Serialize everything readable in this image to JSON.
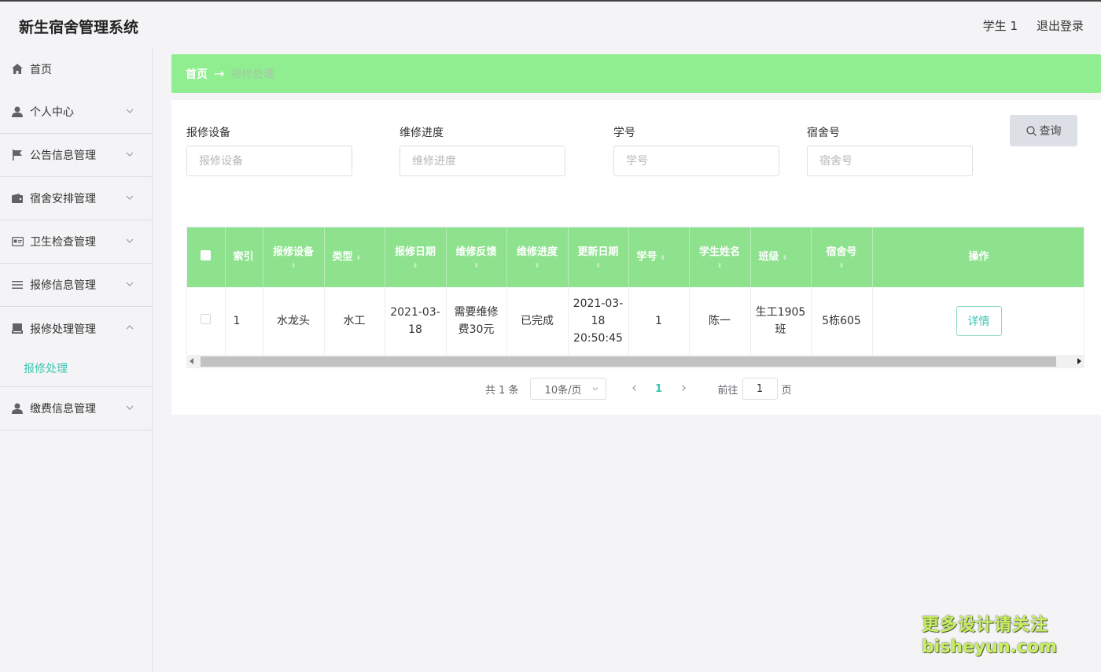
{
  "header": {
    "app_title": "新生宿舍管理系统",
    "user": "学生 1",
    "logout": "退出登录"
  },
  "sidebar": {
    "items": [
      {
        "label": "首页",
        "icon": "home-icon"
      },
      {
        "label": "个人中心",
        "icon": "user-icon"
      },
      {
        "label": "公告信息管理",
        "icon": "flag-icon"
      },
      {
        "label": "宿舍安排管理",
        "icon": "wallet-icon"
      },
      {
        "label": "卫生检查管理",
        "icon": "id-card-icon"
      },
      {
        "label": "报修信息管理",
        "icon": "list-icon"
      },
      {
        "label": "报修处理管理",
        "icon": "tray-icon"
      },
      {
        "label": "缴费信息管理",
        "icon": "person-icon"
      }
    ],
    "submenu": "报修处理"
  },
  "breadcrumb": {
    "home": "首页",
    "arrow": "→",
    "current": "报修处理"
  },
  "search": {
    "fields": [
      {
        "label": "报修设备",
        "placeholder": "报修设备"
      },
      {
        "label": "维修进度",
        "placeholder": "维修进度"
      },
      {
        "label": "学号",
        "placeholder": "学号"
      },
      {
        "label": "宿舍号",
        "placeholder": "宿舍号"
      }
    ],
    "query_label": "查询"
  },
  "table": {
    "headers": [
      "索引",
      "报修设备",
      "类型",
      "报修日期",
      "维修反馈",
      "维修进度",
      "更新日期",
      "学号",
      "学生姓名",
      "班级",
      "宿舍号",
      "操作"
    ],
    "rows": [
      {
        "index": "1",
        "device": "水龙头",
        "type": "水工",
        "report_date": "2021-03-18",
        "feedback": "需要维修费30元",
        "progress": "已完成",
        "update_date": "2021-03-18 20:50:45",
        "student_no": "1",
        "student_name": "陈一",
        "class": "生工1905班",
        "dorm": "5栋605",
        "action": "详情"
      }
    ]
  },
  "pagination": {
    "total": "共 1 条",
    "page_size": "10条/页",
    "current_page": "1",
    "goto_label": "前往",
    "goto_value": "1",
    "page_suffix": "页"
  },
  "watermark": {
    "line1": "更多设计请关注",
    "line2": "bisheyun.com"
  },
  "colors": {
    "accent_green": "#90ee90",
    "header_green": "#8ee28e",
    "teal": "#3cc5b0"
  }
}
